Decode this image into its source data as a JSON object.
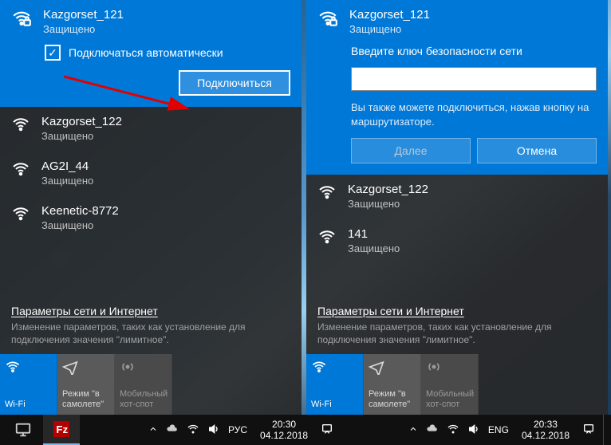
{
  "colors": {
    "accent": "#0078d7"
  },
  "left": {
    "selected": {
      "ssid": "Kazgorset_121",
      "status": "Защищено"
    },
    "auto_label": "Подключаться автоматически",
    "connect_label": "Подключиться",
    "nets": [
      {
        "ssid": "Kazgorset_122",
        "status": "Защищено"
      },
      {
        "ssid": "AG2I_44",
        "status": "Защищено"
      },
      {
        "ssid": "Keenetic-8772",
        "status": "Защищено"
      }
    ]
  },
  "right": {
    "selected": {
      "ssid": "Kazgorset_121",
      "status": "Защищено"
    },
    "prompt": "Введите ключ безопасности сети",
    "key_value": "",
    "hint": "Вы также можете подключиться, нажав кнопку на маршрутизаторе.",
    "next_label": "Далее",
    "cancel_label": "Отмена",
    "nets": [
      {
        "ssid": "Kazgorset_122",
        "status": "Защищено"
      },
      {
        "ssid": "141",
        "status": "Защищено"
      }
    ]
  },
  "settings": {
    "title": "Параметры сети и Интернет",
    "desc": "Изменение параметров, таких как установление для подключения значения \"лимитное\"."
  },
  "tiles": {
    "wifi": "Wi-Fi",
    "airplane": "Режим \"в самолете\"",
    "hotspot": "Мобильный хот-спот"
  },
  "taskbar": {
    "left_lang": "РУС",
    "left_time": "20:30",
    "left_date": "04.12.2018",
    "right_lang": "ENG",
    "right_time": "20:33",
    "right_date": "04.12.2018"
  }
}
